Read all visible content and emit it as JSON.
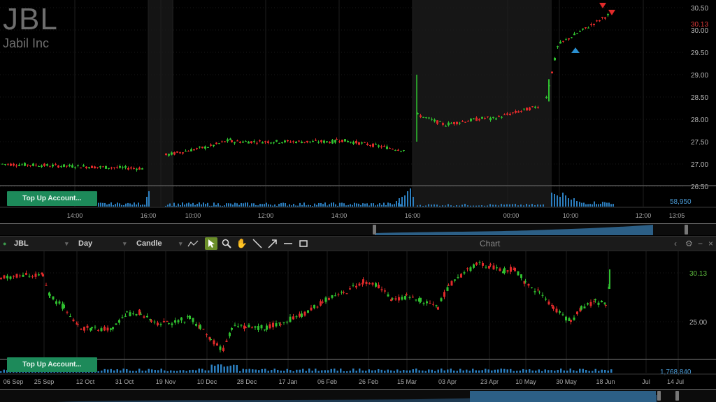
{
  "top_panel": {
    "ticker": "JBL",
    "company": "Jabil Inc",
    "price_labels": [
      "30.50",
      "30.00",
      "29.50",
      "29.00",
      "28.50",
      "28.00",
      "27.50",
      "27.00",
      "26.50"
    ],
    "last_price": "30.13",
    "volume_value": "58,950",
    "time_labels": [
      "14:00",
      "16:00",
      "10:00",
      "12:00",
      "14:00",
      "16:00",
      "00:00",
      "10:00",
      "12:00",
      "13:05"
    ],
    "top_up_label": "Top Up Account..."
  },
  "toolbar": {
    "symbol": "JBL",
    "period": "Day",
    "chart_type": "Candle",
    "title": "Chart"
  },
  "bottom_panel": {
    "price_labels": [
      "30.13",
      "25.00"
    ],
    "volume_value": "1,768,840",
    "date_labels": [
      "06 Sep",
      "25 Sep",
      "12 Oct",
      "31 Oct",
      "19 Nov",
      "10 Dec",
      "28 Dec",
      "17 Jan",
      "06 Feb",
      "26 Feb",
      "15 Mar",
      "03 Apr",
      "23 Apr",
      "10 May",
      "30 May",
      "18 Jun",
      "Jul",
      "14 Jul"
    ],
    "top_up_label": "Top Up Account..."
  },
  "colors": {
    "up": "#2fc02f",
    "down": "#e02a2a",
    "volume": "#2c7fc0",
    "accent_green": "#1d8a5a",
    "last_price": "#e03a3a",
    "last_price_daily": "#5fbf3f"
  },
  "icons": [
    "draw-line-icon",
    "cursor-icon",
    "zoom-icon",
    "pan-hand-icon",
    "line-tool-icon",
    "arrow-tool-icon",
    "horizontal-line-icon",
    "rectangle-icon",
    "settings-icon",
    "close-icon",
    "collapse-icon"
  ]
}
